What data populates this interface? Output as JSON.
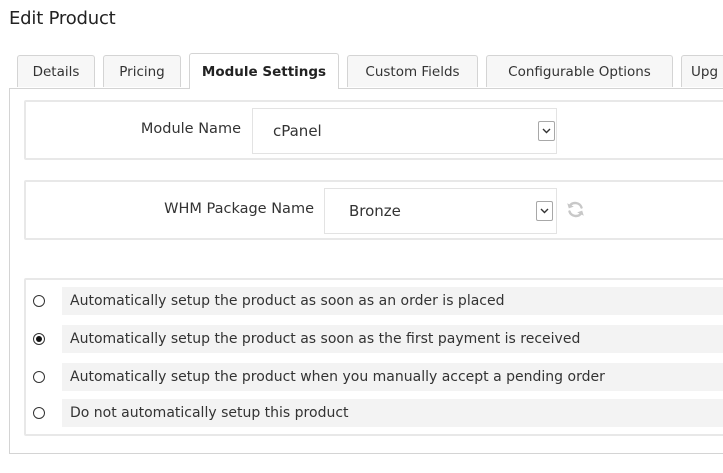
{
  "page": {
    "title": "Edit Product"
  },
  "tabs": [
    {
      "label": "Details"
    },
    {
      "label": "Pricing"
    },
    {
      "label": "Module Settings"
    },
    {
      "label": "Custom Fields"
    },
    {
      "label": "Configurable Options"
    },
    {
      "label": "Upg"
    }
  ],
  "active_tab": "Module Settings",
  "module_settings": {
    "module_name": {
      "label": "Module Name",
      "value": "cPanel"
    },
    "package_name": {
      "label": "WHM Package Name",
      "value": "Bronze"
    }
  },
  "setup_options": [
    {
      "label": "Automatically setup the product as soon as an order is placed",
      "checked": false
    },
    {
      "label": "Automatically setup the product as soon as the first payment is received",
      "checked": true
    },
    {
      "label": "Automatically setup the product when you manually accept a pending order",
      "checked": false
    },
    {
      "label": "Do not automatically setup this product",
      "checked": false
    }
  ],
  "icons": {
    "select_arrow": "chevron-down-icon",
    "refresh": "refresh-icon"
  },
  "colors": {
    "border": "#d4d4d4",
    "option_bg": "#f3f3f3",
    "icon_gray": "#c8c8c8"
  }
}
